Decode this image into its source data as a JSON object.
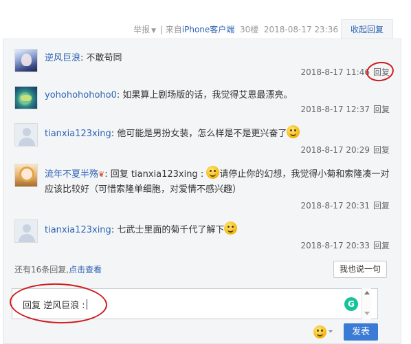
{
  "meta": {
    "report": "举报",
    "separator": "|",
    "source_prefix": "来自",
    "source_link": "iPhone客户端",
    "floor": "30楼",
    "datetime": "2018-08-17 23:36",
    "collapse_label": "收起回复"
  },
  "replies": [
    {
      "user": "逆风巨浪",
      "colon": ":",
      "text": " 不敢苟同",
      "time": "2018-8-17 11:46",
      "reply_label": "回复"
    },
    {
      "user": "yohohohohoho0",
      "colon": ":",
      "text": " 如果算上剧场版的话，我觉得艾恩最漂亮。",
      "time": "2018-8-17 12:37",
      "reply_label": "回复"
    },
    {
      "user": "tianxia123xing",
      "colon": ":",
      "text": " 他可能是男扮女装，怎么样是不是更兴奋了",
      "time": "2018-8-17 20:29",
      "reply_label": "回复"
    },
    {
      "user": "流年不夏半殇",
      "colon": ":",
      "text_prefix": " 回复 tianxia123xing :",
      "text": "请停止你的幻想，我觉得小菊和索隆凑一对应该比较好（可惜索隆单细胞，对爱情不感兴趣）",
      "time": "2018-8-17 20:31",
      "reply_label": "回复"
    },
    {
      "user": "tianxia123xing",
      "colon": ":",
      "text": " 七武士里面的菊千代了解下",
      "time": "2018-8-17 20:33",
      "reply_label": "回复"
    }
  ],
  "footer": {
    "more_text": "还有16条回复,",
    "more_link": "点击查看",
    "say_button": "我也说一句",
    "editor_text": "回复 逆风巨浪 :",
    "grammarly_glyph": "G",
    "send_button": "发表"
  }
}
